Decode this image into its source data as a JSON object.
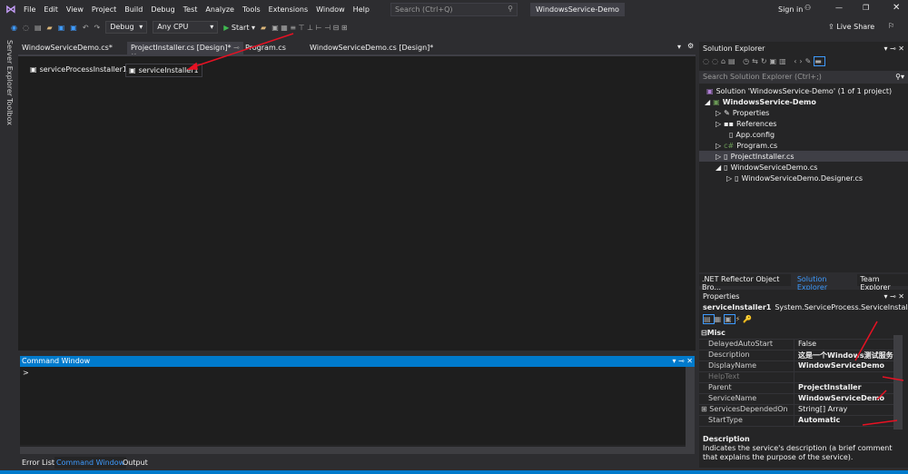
{
  "menu": {
    "items": [
      "File",
      "Edit",
      "View",
      "Project",
      "Build",
      "Debug",
      "Test",
      "Analyze",
      "Tools",
      "Extensions",
      "Window",
      "Help"
    ],
    "search_placeholder": "Search (Ctrl+Q)",
    "window_title": "WindowsService-Demo",
    "sign_in": "Sign in",
    "live_share": "Live Share"
  },
  "toolbar": {
    "config": "Debug",
    "platform": "Any CPU",
    "start": "Start"
  },
  "side": {
    "server_explorer": "Server Explorer",
    "toolbox": "Toolbox"
  },
  "tabs": [
    "WindowServiceDemo.cs*",
    "ProjectInstaller.cs [Design]*",
    "Program.cs",
    "WindowServiceDemo.cs [Design]*"
  ],
  "designer": {
    "components": [
      "serviceProcessInstaller1",
      "serviceInstaller1"
    ]
  },
  "command_window": {
    "title": "Command Window",
    "prompt": ">"
  },
  "bottom_tabs": [
    "Error List",
    "Command Window",
    "Output"
  ],
  "solution_explorer": {
    "title": "Solution Explorer",
    "search_placeholder": "Search Solution Explorer (Ctrl+;)",
    "items": [
      "Solution 'WindowsService-Demo' (1 of 1 project)",
      "WindowsService-Demo",
      "Properties",
      "References",
      "App.config",
      "Program.cs",
      "ProjectInstaller.cs",
      "WindowServiceDemo.cs",
      "WindowServiceDemo.Designer.cs"
    ],
    "tabs": [
      ".NET Reflector Object Bro...",
      "Solution Explorer",
      "Team Explorer"
    ]
  },
  "properties": {
    "title": "Properties",
    "object": "serviceInstaller1",
    "type": "System.ServiceProcess.ServiceInstaller",
    "category": "Misc",
    "rows": [
      {
        "k": "DelayedAutoStart",
        "v": "False"
      },
      {
        "k": "Description",
        "v": "这是一个Windows测试服务"
      },
      {
        "k": "DisplayName",
        "v": "WindowServiceDemo"
      },
      {
        "k": "HelpText",
        "v": ""
      },
      {
        "k": "Parent",
        "v": "ProjectInstaller"
      },
      {
        "k": "ServiceName",
        "v": "WindowServiceDemo"
      },
      {
        "k": "ServicesDependedOn",
        "v": "String[] Array"
      },
      {
        "k": "StartType",
        "v": "Automatic"
      }
    ],
    "desc_title": "Description",
    "desc_text": "Indicates the service's description (a brief comment that explains the purpose of the service)."
  },
  "colors": {
    "accent": "#007acc",
    "annotation": "#e81123"
  }
}
